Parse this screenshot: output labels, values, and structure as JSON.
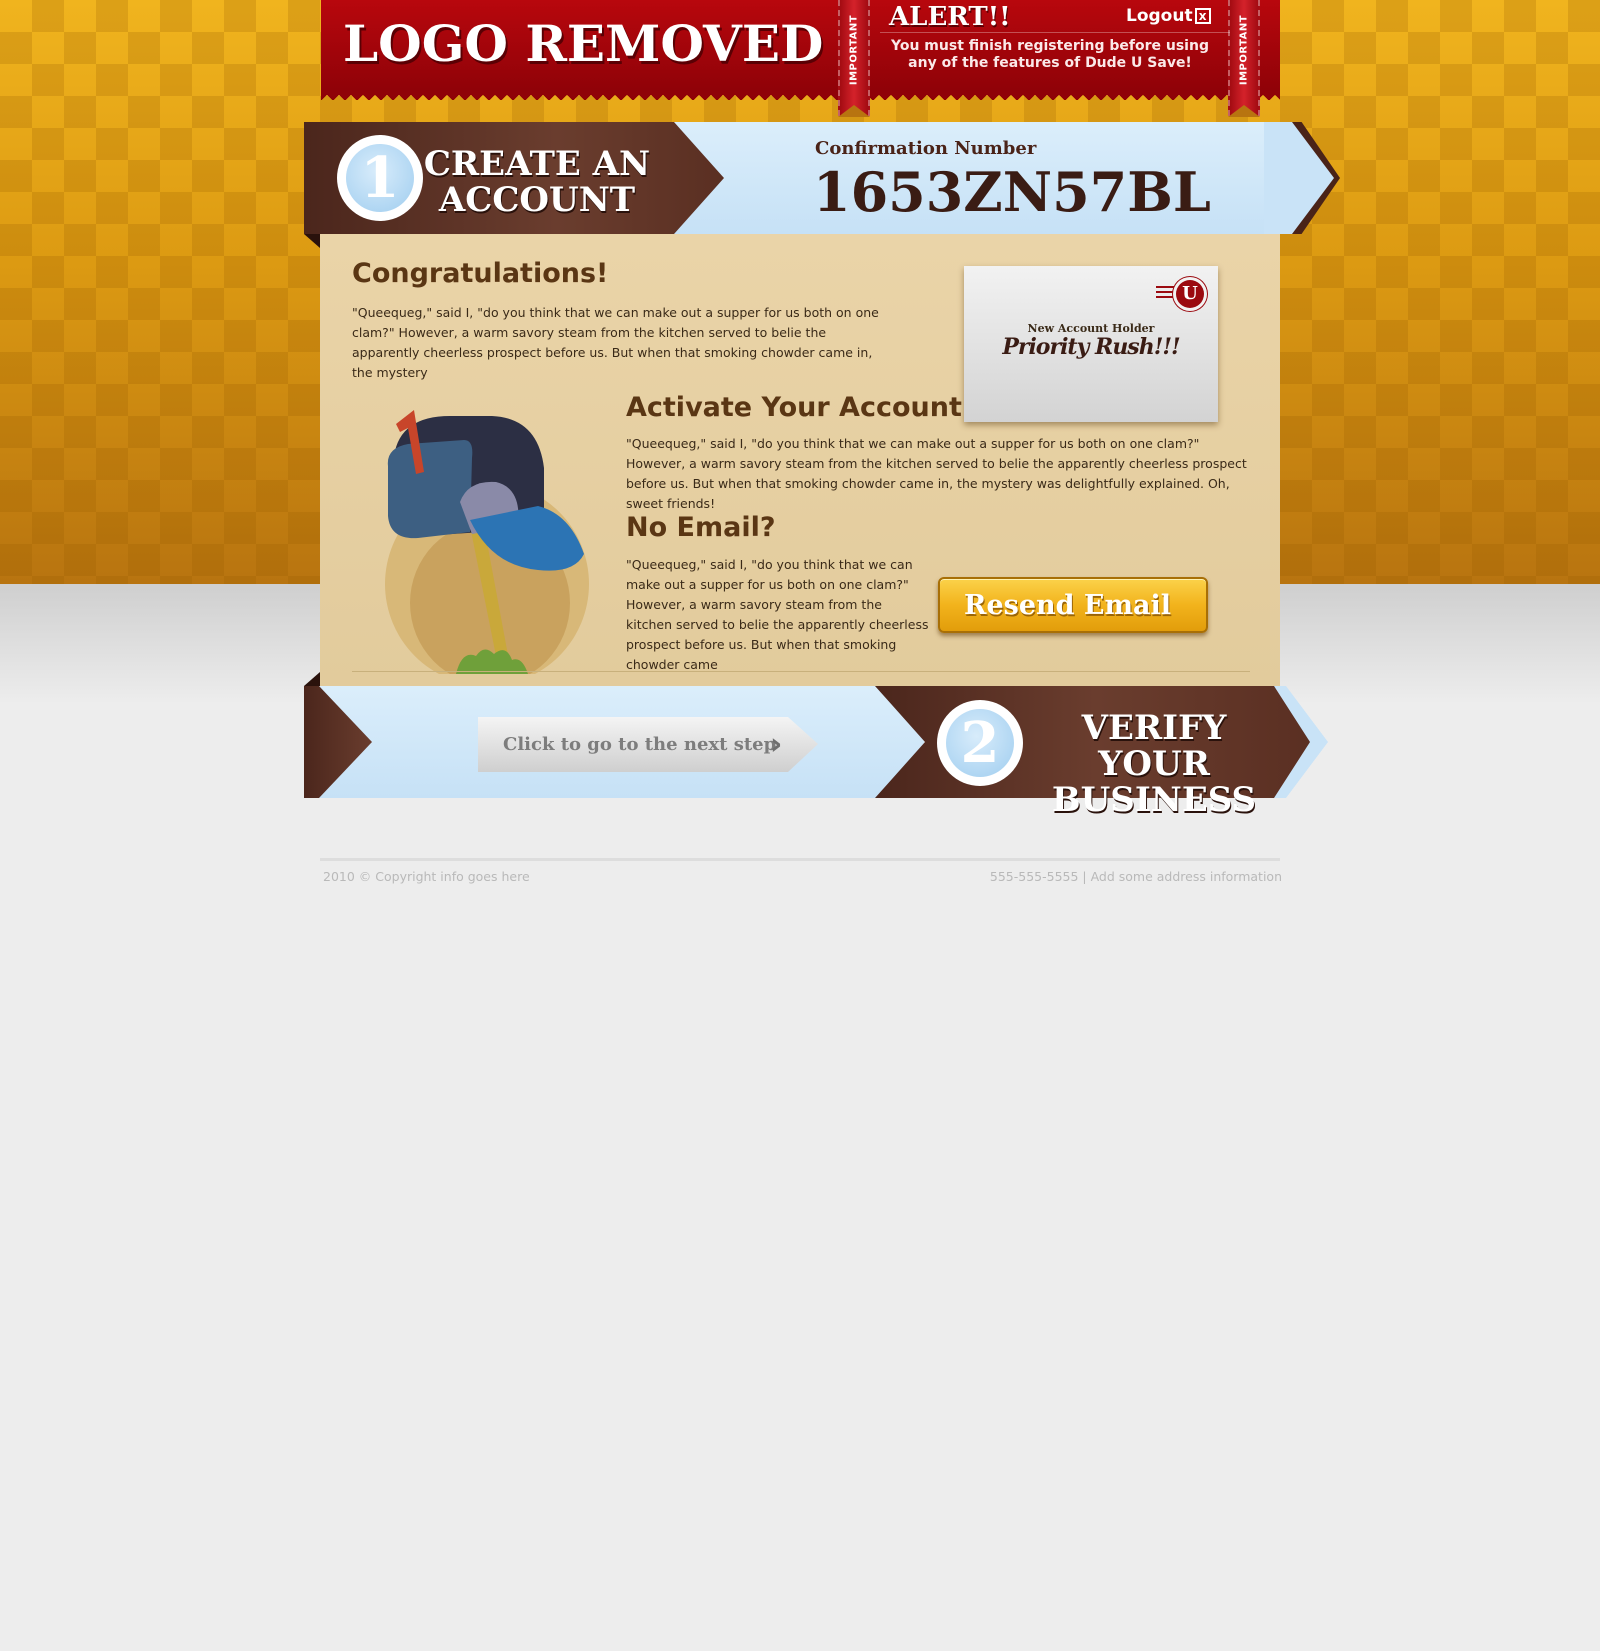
{
  "header": {
    "logo_text": "LOGO REMOVED",
    "ribbon_label": "IMPORTANT",
    "alert_title": "ALERT!!",
    "logout_label": "Logout",
    "logout_icon": "x",
    "alert_message": "You must finish registering before using any of the features of Dude U Save!"
  },
  "step1": {
    "number": "1",
    "title": "CREATE AN ACCOUNT",
    "confirmation_label": "Confirmation Number",
    "confirmation_number": "1653ZN57BL"
  },
  "content": {
    "congrats_title": "Congratulations!",
    "congrats_text": "\"Queequeg,\" said I, \"do you think that we can make out a supper for us both on one clam?\" However, a warm savory steam from the kitchen served to belie the apparently cheerless prospect before us. But when that smoking chowder came in, the mystery",
    "card_stamp_letter": "U",
    "card_small": "New Account Holder",
    "card_big": "Priority Rush!!!",
    "activate_title": "Activate Your Account",
    "activate_text": "\"Queequeg,\" said I, \"do you think that we can make out a supper for us both on one clam?\" However, a warm savory steam from the kitchen served to belie the apparently cheerless prospect before us. But when that smoking chowder came in, the mystery was delightfully explained. Oh, sweet friends!",
    "noemail_title": "No Email?",
    "noemail_text": "\"Queequeg,\" said I, \"do you think that we can make out a supper for us both on one clam?\" However, a warm savory steam from the kitchen served to belie the apparently cheerless prospect before us. But when that smoking chowder came",
    "resend_label": "Resend Email"
  },
  "step2": {
    "next_label": "Click to go to the next step",
    "number": "2",
    "title": "VERIFY YOUR BUSINESS"
  },
  "footer": {
    "copyright": "2010 © Copyright info goes here",
    "contact": "555-555-5555 | Add some address information"
  },
  "colors": {
    "header_red": "#9f050b",
    "banner_brown": "#5a2f22",
    "banner_blue": "#c9e3f7",
    "panel_tan": "#e6cfa2",
    "button_gold": "#f2b31c",
    "heading_brown": "#5a3614"
  }
}
